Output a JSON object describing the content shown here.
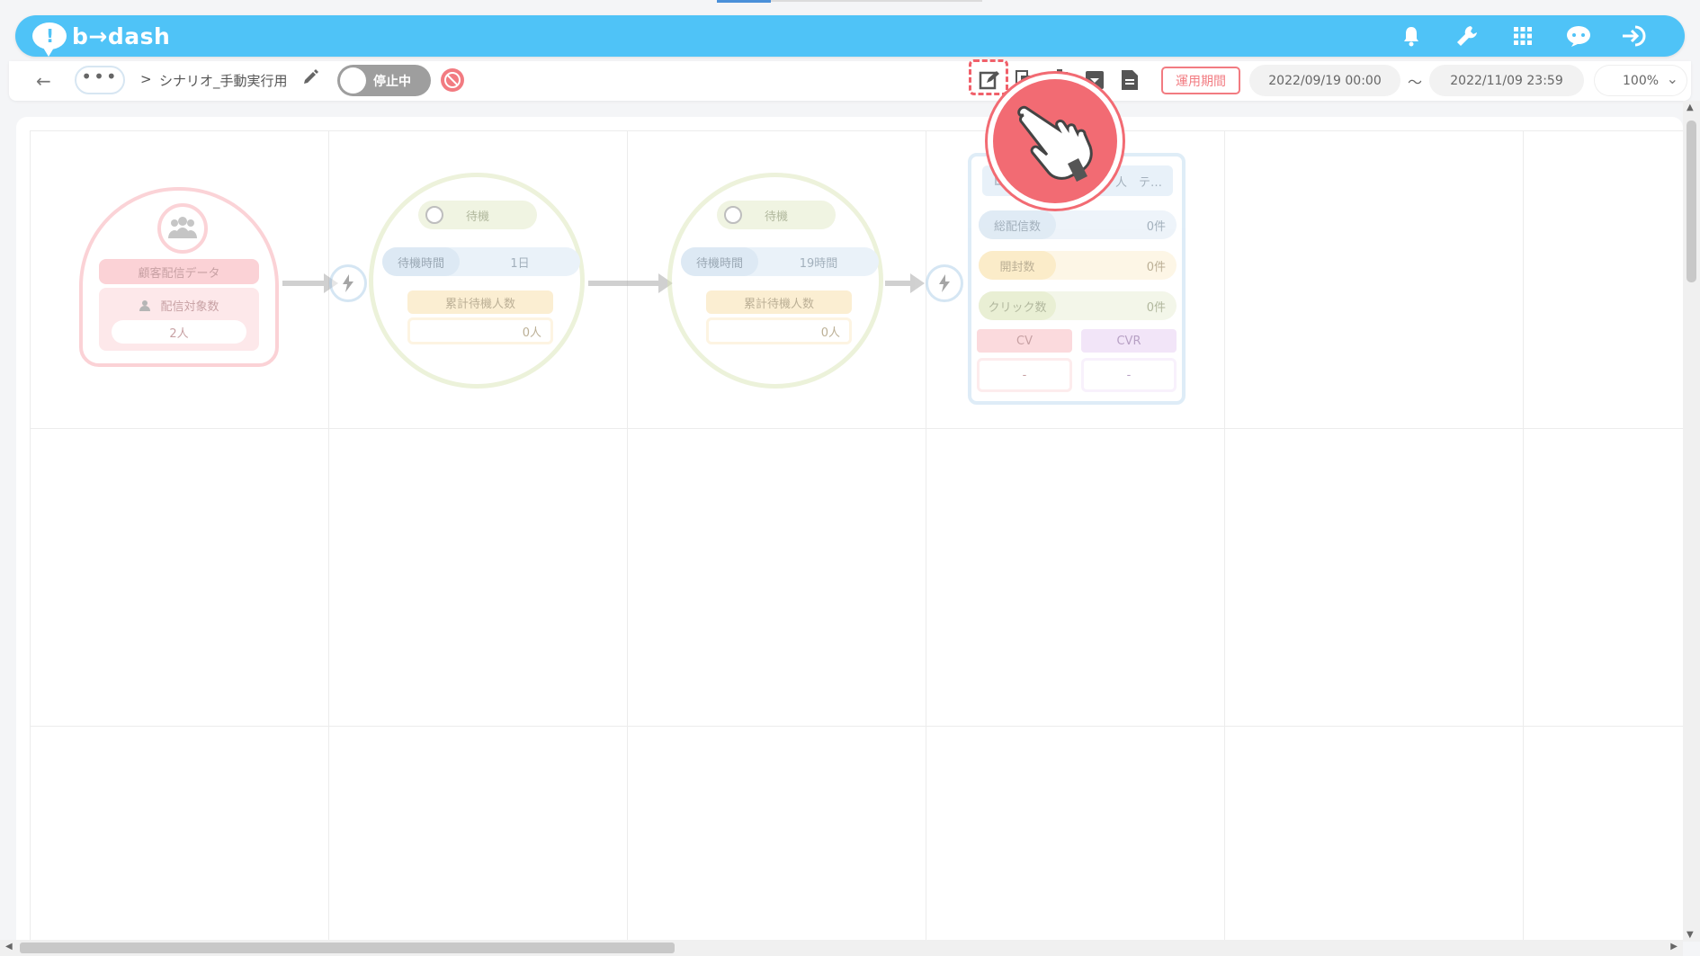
{
  "app": {
    "logo_text": "b→dash",
    "brand_color": "#4fc3f7"
  },
  "header_icons": [
    "bell-icon",
    "wrench-icon",
    "apps-grid-icon",
    "chat-bot-icon",
    "logout-icon"
  ],
  "toolbar": {
    "more_label": "•••",
    "breadcrumb_sep": ">",
    "scenario_name": "シナリオ_手動実行用",
    "status_toggle_label": "停止中",
    "period_button": "運用期間",
    "date_start": "2022/09/19 00:00",
    "date_tilde": "〜",
    "date_end": "2022/11/09 23:59",
    "zoom": "100%"
  },
  "nodes": {
    "start": {
      "title": "顧客配信データ",
      "count_label": "配信対象数",
      "count_value": "2人"
    },
    "wait1": {
      "head": "待機",
      "time_label": "待機時間",
      "time_value": "1日",
      "cum_label": "累計待機人数",
      "cum_value": "0人"
    },
    "wait2": {
      "head": "待機",
      "time_label": "待機時間",
      "time_value": "19時間",
      "cum_label": "累計待機人数",
      "cum_value": "0人"
    },
    "mail": {
      "head_text": "人　テ…",
      "sent_label": "総配信数",
      "sent_value": "0件",
      "open_label": "開封数",
      "open_value": "0件",
      "click_label": "クリック数",
      "click_value": "0件",
      "cv_label": "CV",
      "cv_value": "-",
      "cvr_label": "CVR",
      "cvr_value": "-"
    }
  }
}
